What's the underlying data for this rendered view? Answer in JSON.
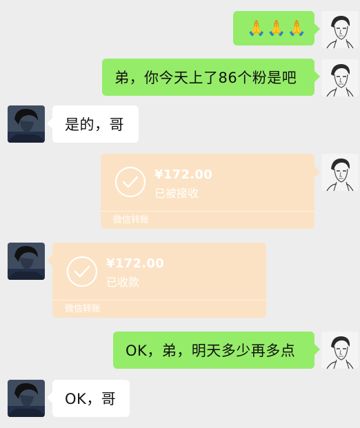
{
  "messages": [
    {
      "side": "right",
      "type": "text",
      "text": "🙏🙏🙏"
    },
    {
      "side": "right",
      "type": "text",
      "text": "弟，你今天上了86个粉是吧"
    },
    {
      "side": "left",
      "type": "text",
      "text": "是的，哥"
    },
    {
      "side": "right",
      "type": "transfer",
      "amount": "¥172.00",
      "status": "已被接收",
      "label": "微信转账"
    },
    {
      "side": "left",
      "type": "transfer",
      "amount": "¥172.00",
      "status": "已收款",
      "label": "微信转账"
    },
    {
      "side": "right",
      "type": "text",
      "text": "OK，弟，明天多少再多点"
    },
    {
      "side": "left",
      "type": "text",
      "text": "OK，哥"
    }
  ],
  "colors": {
    "background": "#ededed",
    "sent_bubble": "#95ec69",
    "received_bubble": "#ffffff",
    "transfer_card": "#fbe2c4"
  },
  "icons": {
    "self_avatar": "sketch-man-avatar",
    "other_avatar": "dark-photo-avatar",
    "transfer_done": "check-circle-icon"
  }
}
